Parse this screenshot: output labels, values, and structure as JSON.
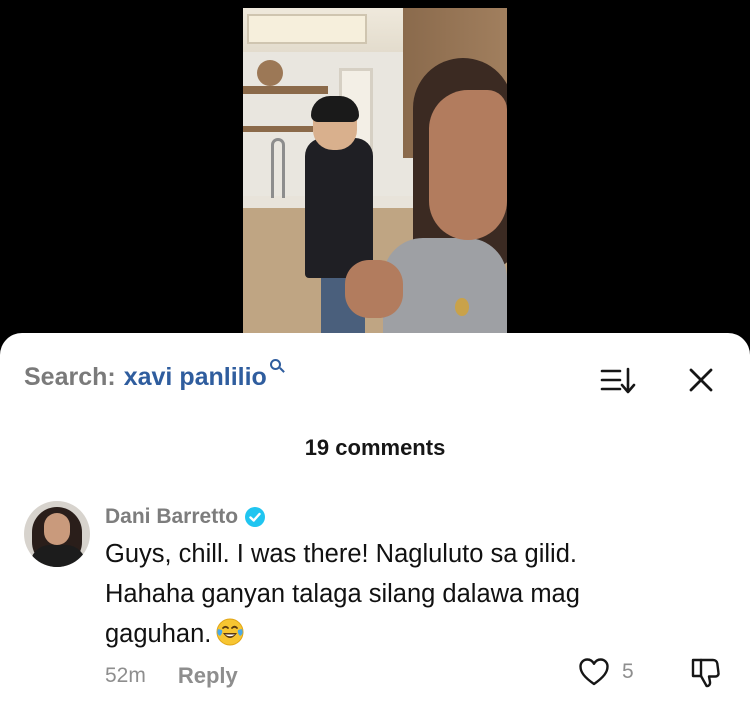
{
  "search": {
    "prefix": "Search:",
    "term": "xavi panlilio",
    "icon": "search-icon"
  },
  "header": {
    "sort_icon": "sort-icon",
    "close_icon": "close-icon"
  },
  "comments_count": "19 comments",
  "comment": {
    "author": "Dani Barretto",
    "verified": true,
    "verified_color": "#20c5f0",
    "lines": [
      "Guys, chill. I was there! Nagluluto sa gilid.",
      "Hahaha ganyan talaga silang dalawa mag",
      "gaguhan."
    ],
    "emoji": "face-with-tears-of-joy",
    "timestamp": "52m",
    "reply_label": "Reply",
    "like_count": "5"
  },
  "colors": {
    "search_term": "#2f5d9e",
    "muted_text": "#8e8e8e",
    "background": "#ffffff",
    "video_background": "#000000"
  }
}
